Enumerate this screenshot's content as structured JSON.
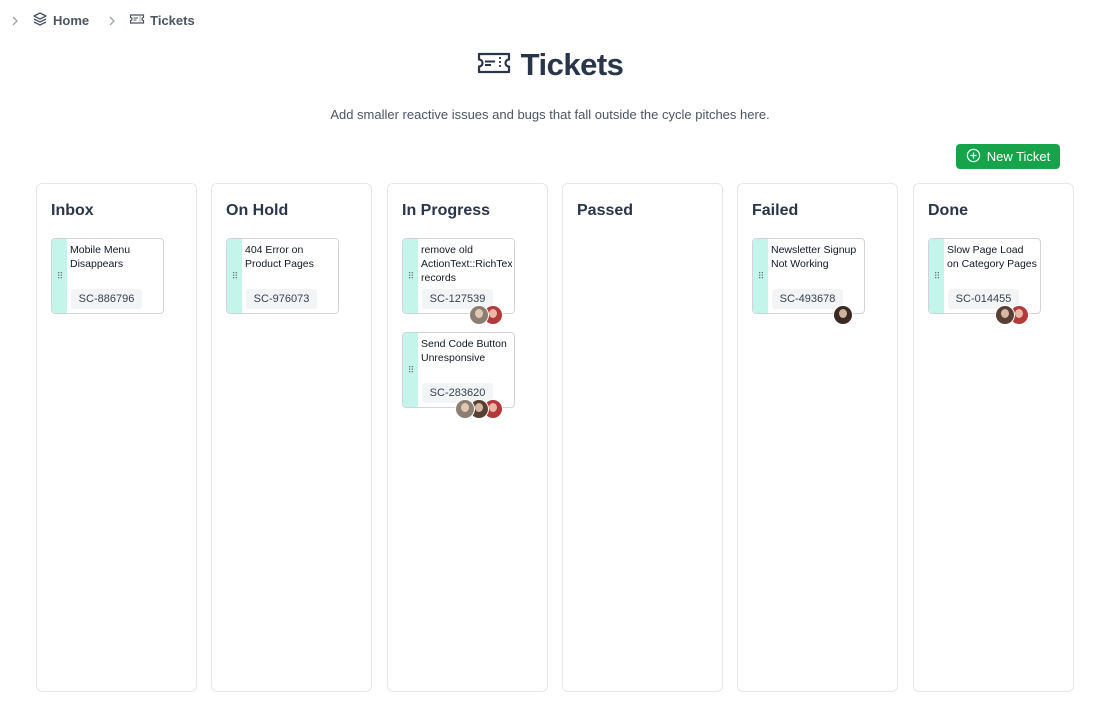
{
  "breadcrumb": {
    "home_label": "Home",
    "tickets_label": "Tickets"
  },
  "header": {
    "title": "Tickets",
    "subtitle": "Add smaller reactive issues and bugs that fall outside the cycle pitches here.",
    "icon": "ticket-icon"
  },
  "actions": {
    "new_ticket_label": "New Ticket"
  },
  "colors": {
    "accent_green": "#16a34a",
    "card_stripe": "#c4f5ea"
  },
  "columns": [
    {
      "title": "Inbox"
    },
    {
      "title": "On Hold"
    },
    {
      "title": "In Progress"
    },
    {
      "title": "Passed"
    },
    {
      "title": "Failed"
    },
    {
      "title": "Done"
    }
  ],
  "cards": {
    "inbox_1": {
      "title": "Mobile Menu Disappears",
      "code": "SC-886796"
    },
    "hold_1": {
      "title": "404 Error on Product Pages",
      "code": "SC-976073"
    },
    "progress_1": {
      "title": "remove old ActionText::RichText records",
      "code": "SC-127539"
    },
    "progress_2": {
      "title": "Send Code Button Unresponsive",
      "code": "SC-283620"
    },
    "failed_1": {
      "title": "Newsletter Signup Not Working",
      "code": "SC-493678"
    },
    "done_1": {
      "title": "Slow Page Load on Category Pages",
      "code": "SC-014455"
    }
  }
}
